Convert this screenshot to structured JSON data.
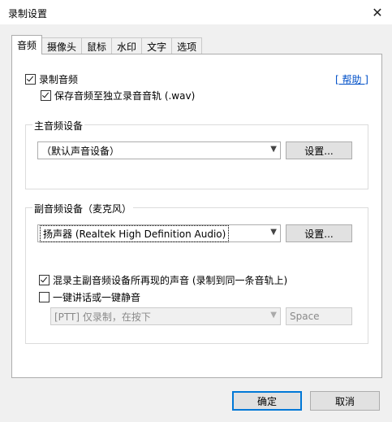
{
  "window": {
    "title": "录制设置",
    "close_glyph": "✕"
  },
  "tabs": [
    {
      "label": "音频"
    },
    {
      "label": "摄像头"
    },
    {
      "label": "鼠标"
    },
    {
      "label": "水印"
    },
    {
      "label": "文字"
    },
    {
      "label": "选项"
    }
  ],
  "audio": {
    "record_audio": {
      "label": "录制音频",
      "checked": true
    },
    "help_link": "[ 帮助 ]",
    "save_separate": {
      "label": "保存音频至独立录音音轨 (.wav)",
      "checked": true
    },
    "main_group": {
      "label": "主音频设备",
      "device_value": "（默认声音设备）",
      "settings_button": "设置..."
    },
    "sub_group": {
      "label": "副音频设备（麦克风）",
      "device_value": "扬声器 (Realtek High Definition Audio)",
      "settings_button": "设置...",
      "mix_option": {
        "label": "混录主副音频设备所再现的声音 (录制到同一条音轨上)",
        "checked": true
      },
      "ptt_option": {
        "label": "一键讲话或一键静音",
        "checked": false
      },
      "ptt_mode_value": "[PTT] 仅录制，在按下",
      "ptt_key_value": "Space"
    }
  },
  "footer": {
    "ok_button": "确定",
    "cancel_button": "取消"
  }
}
